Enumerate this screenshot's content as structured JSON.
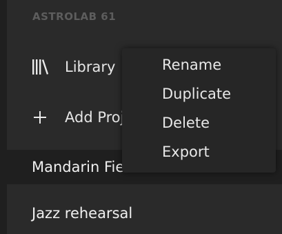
{
  "sidebar": {
    "device_label": "ASTROLAB 61",
    "items": [
      {
        "label": "Library",
        "icon": "library-icon"
      },
      {
        "label": "Add Project",
        "icon": "plus-icon"
      }
    ]
  },
  "projects": [
    {
      "label": "Mandarin Fields",
      "selected": true
    },
    {
      "label": "Jazz rehearsal",
      "selected": false
    }
  ],
  "context_menu": {
    "items": [
      "Rename",
      "Duplicate",
      "Delete",
      "Export"
    ]
  }
}
